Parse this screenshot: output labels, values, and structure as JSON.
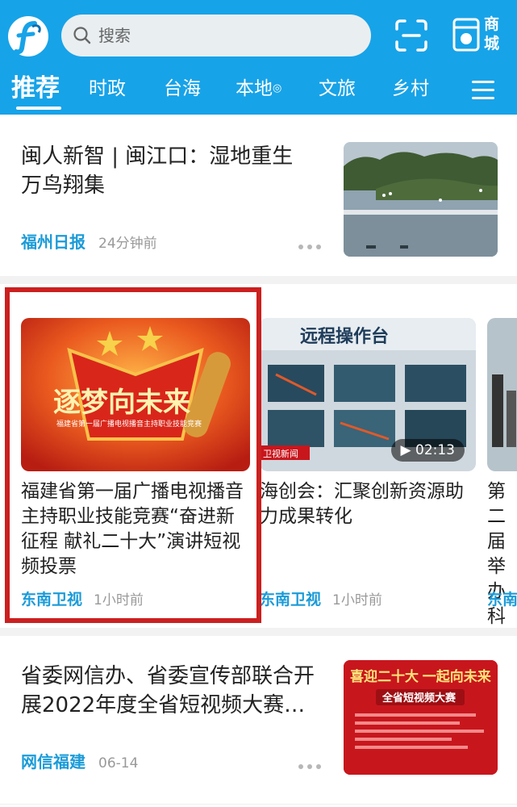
{
  "header": {
    "search_placeholder": "搜索",
    "mall_label": "商城",
    "accent_color": "#17a3e8"
  },
  "tabs": [
    {
      "label": "推荐",
      "active": true
    },
    {
      "label": "时政"
    },
    {
      "label": "台海"
    },
    {
      "label": "本地"
    },
    {
      "label": "文旅"
    },
    {
      "label": "乡村"
    }
  ],
  "articles": [
    {
      "title": "闽人新智 | 闽江口：湿地重生 万鸟翔集",
      "source": "福州日报",
      "time": "24分钟前",
      "thumb_icon": "wetland-birds-photo"
    }
  ],
  "carousel": [
    {
      "title": "福建省第一届广播电视播音主持职业技能竞赛“奋进新征程  献礼二十大”演讲短视频投票",
      "source": "东南卫视",
      "time": "1小时前",
      "image_caption_big": "逐梦向未来",
      "image_caption_small": "福建省第一届广播电视播音主持职业技能竞赛",
      "highlighted": true
    },
    {
      "title": "海创会：汇聚创新资源助力成果转化",
      "source": "东南卫视",
      "time": "1小时前",
      "image_banner": "远程操作台",
      "image_tag": "卫视新闻",
      "duration": "02:13"
    },
    {
      "title": "第二届 举办 科技",
      "source": "东南"
    }
  ],
  "articles_bottom": [
    {
      "title": "省委网信办、省委宣传部联合开展2022年度全省短视频大赛…",
      "source": "网信福建",
      "time": "06-14",
      "image_banner": "喜迎二十大 一起向未来",
      "image_sub": "全省短视频大赛"
    }
  ]
}
